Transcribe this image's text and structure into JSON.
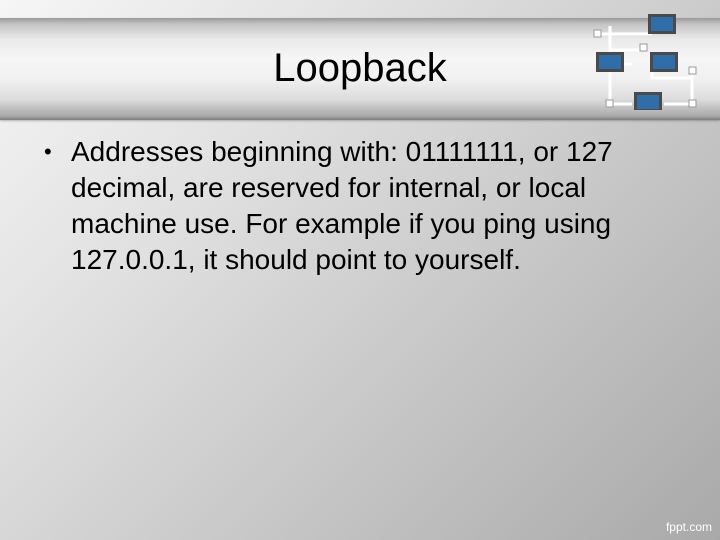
{
  "slide": {
    "title": "Loopback",
    "bullets": [
      {
        "symbol": "•",
        "text": "Addresses beginning with: 01111111, or 127 decimal, are reserved for internal, or local machine use. For example if you ping using 127.0.0.1, it should point to yourself."
      }
    ],
    "decoration_icon": "network-diagram-icon",
    "watermark": "fppt.com"
  },
  "colors": {
    "background": "#c9c9c9",
    "title_band": "#f0f0f0",
    "text": "#000000",
    "icon_monitor": "#2f6ea8",
    "icon_lines": "#ffffff"
  }
}
